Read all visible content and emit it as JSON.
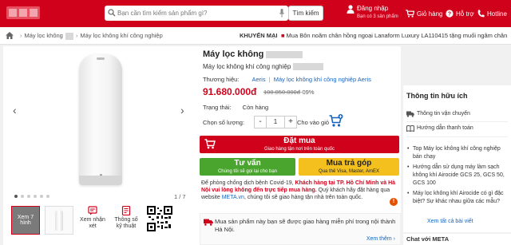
{
  "header": {
    "search_placeholder": "Bạn cần tìm kiếm sản phẩm gì?",
    "search_button": "Tìm kiếm",
    "login_label": "Đăng nhập",
    "login_sub": "Bạn có 3 sản phẩm",
    "cart_label": "Giỏ hàng",
    "support_label": "Hỗ trợ",
    "hotline_label": "Hotline"
  },
  "breadcrumb": {
    "item1": "Máy lọc không",
    "item2": "Máy lọc không khí công nghiệp"
  },
  "promo": {
    "label": "KHUYẾN MẠI",
    "text": "Mua Bôn noãm chân hồng ngoại Lanaform Luxury LA110415 tặng muối ngâm chân"
  },
  "gallery": {
    "counter": "1 / 7",
    "prev": "‹",
    "next": "›",
    "video_label": "Xem 7 hình",
    "tool_reviews": "Xem nhận xét",
    "tool_specs": "Thông số kỹ thuật"
  },
  "product": {
    "title": "Máy lọc không",
    "subtitle": "Máy lọc không khí công nghiệp",
    "brand_label": "Thương hiệu:",
    "brand_value": "Aeris",
    "brand_sep": "|",
    "brand_category": "Máy lọc không khí công nghiệp Aeris",
    "price": "91.680.000đ",
    "old_price": "100.850.000đ",
    "discount": "-09%",
    "status_label": "Trạng thái:",
    "status_value": "Còn hàng",
    "qty_label": "Chọn số lượng:",
    "qty_value": "1",
    "qty_minus": "-",
    "qty_plus": "+",
    "add_cart_label": "Cho vào giỏ"
  },
  "buttons": {
    "buy_title": "Đặt mua",
    "buy_sub": "Giao hàng tận nơi trên toàn quốc",
    "consult_title": "Tư vấn",
    "consult_sub": "Chúng tôi sẽ gọi lại cho bạn",
    "install_title": "Mua trả góp",
    "install_sub": "Qua thẻ Visa, Master, AmEX"
  },
  "notice": {
    "part1": "Để phòng chống dịch bệnh Covid-19,",
    "part2": "Khách hàng tại TP. Hồ Chí Minh và Hà Nội vui lòng không đến trực tiếp mua hàng.",
    "part3": "Quý khách hãy đặt hàng qua website",
    "link": "META.vn",
    "part4": ", chúng tôi sẽ giao hàng tận nhà trên toàn quốc."
  },
  "shipping": {
    "text": "Mua sản phẩm này bạn sẽ được giao hàng miễn phí trong nội thành Hà Nội.",
    "more": "Xem thêm ›"
  },
  "sidebar": {
    "title": "Thông tin hữu ích",
    "item1": "Thông tin vận chuyển",
    "item2": "Hướng dẫn thanh toán",
    "news": [
      "Top Máy lọc không khí công nghiệp bán chạy",
      "Hướng dẫn sử dụng máy làm sạch không khí Airocide GCS 25, GCS 50, GCS 100",
      "Máy lọc không khí Airocide có gì đặc biệt? Sự khác nhau giữa các mẫu?"
    ],
    "all_news": "Xem tất cả bài viết",
    "chat": "Chat với META"
  },
  "colors": {
    "brand_red": "#d0021b",
    "consult_green": "#4aa52e",
    "install_yellow": "#f3c01d",
    "link_blue": "#1565c0"
  }
}
